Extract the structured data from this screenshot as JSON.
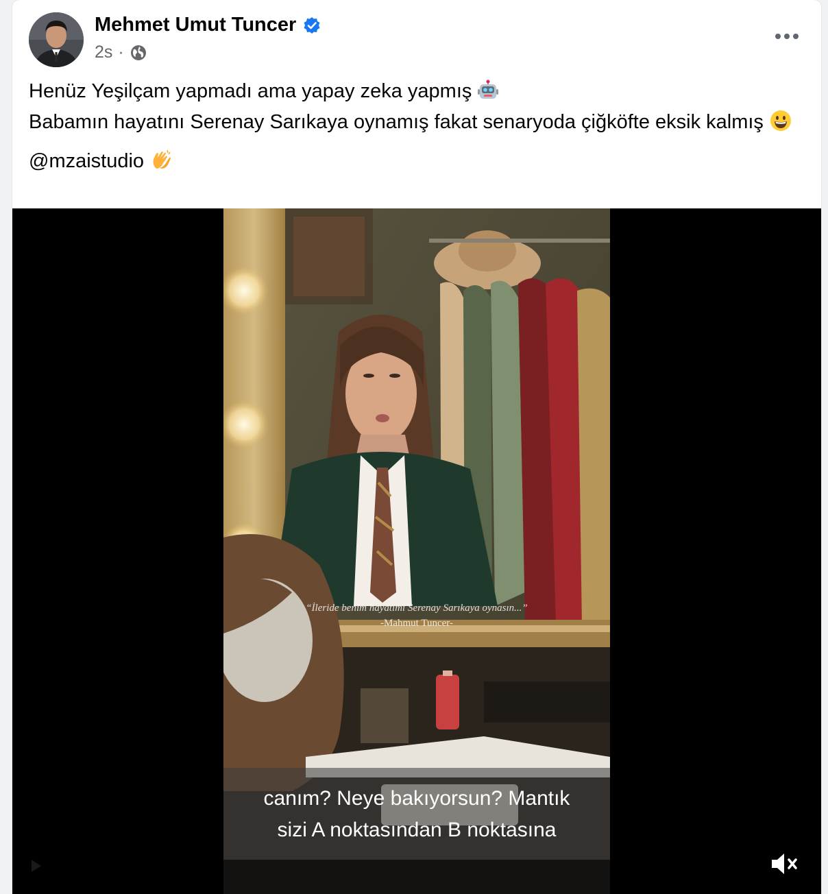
{
  "post": {
    "author": "Mehmet Umut Tuncer",
    "time": "2s",
    "separator": "·",
    "verified_icon": "verified-badge-icon",
    "audience_icon": "globe-icon",
    "more_icon": "more-options-icon",
    "text_line1": "Henüz Yeşilçam yapmadı ama yapay zeka yapmış",
    "text_line1_emoji": "🤖",
    "text_line2": "Babamın hayatını Serenay Sarıkaya oynamış fakat senaryoda çiğköfte eksik kalmış",
    "text_line2_emoji": "😀",
    "mention": "@mzaistudio",
    "mention_emoji": "👏"
  },
  "video": {
    "quote_line1": "“İleride benim hayatımı Serenay Sarıkaya oynasın...”",
    "quote_line2": "-Mahmut Tuncer-",
    "caption_line1": "canım? Neye bakıyorsun? Mantık",
    "caption_line2": "sizi A noktasından B noktasına",
    "mute_icon": "muted-speaker-icon"
  },
  "colors": {
    "brand_blue": "#1877f2",
    "text_primary": "#050505",
    "text_secondary": "#65676b"
  }
}
